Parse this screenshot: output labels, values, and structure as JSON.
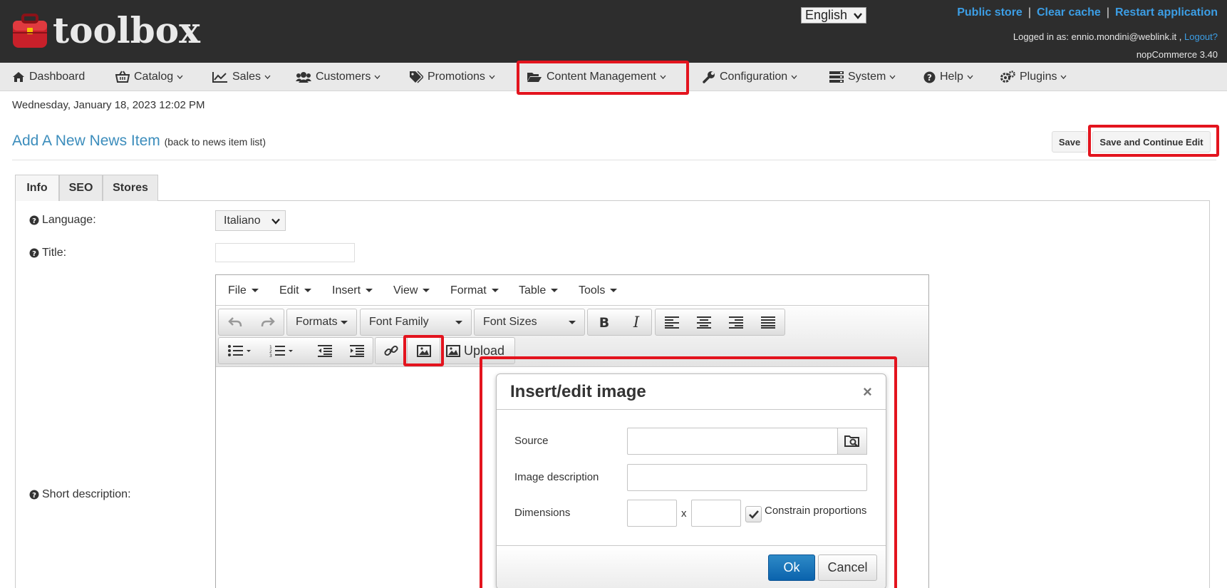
{
  "header": {
    "logo_text": "toolbox",
    "language": "English",
    "links": {
      "public_store": "Public store",
      "clear_cache": "Clear cache",
      "restart": "Restart application"
    },
    "logged_in_prefix": "Logged in as: ennio.mondini@weblink.it ,",
    "logout": "Logout?",
    "version": "nopCommerce 3.40"
  },
  "nav": {
    "items": [
      {
        "label": "Dashboard",
        "icon": "home-icon"
      },
      {
        "label": "Catalog",
        "icon": "basket-icon"
      },
      {
        "label": "Sales",
        "icon": "line-chart-icon"
      },
      {
        "label": "Customers",
        "icon": "users-icon"
      },
      {
        "label": "Promotions",
        "icon": "tags-icon"
      },
      {
        "label": "Content Management",
        "icon": "folder-open-icon"
      },
      {
        "label": "Configuration",
        "icon": "wrench-icon"
      },
      {
        "label": "System",
        "icon": "server-icon"
      },
      {
        "label": "Help",
        "icon": "question-circle-icon"
      },
      {
        "label": "Plugins",
        "icon": "gears-icon"
      }
    ]
  },
  "page": {
    "date": "Wednesday, January 18, 2023 12:02 PM",
    "title": "Add A New News Item",
    "back_link": "(back to news item list)",
    "save": "Save",
    "save_continue": "Save and Continue Edit"
  },
  "tabs": [
    "Info",
    "SEO",
    "Stores"
  ],
  "form": {
    "language_label": "Language:",
    "language_value": "Italiano",
    "title_label": "Title:",
    "short_desc_label": "Short description:"
  },
  "editor": {
    "menu": [
      "File",
      "Edit",
      "Insert",
      "View",
      "Format",
      "Table",
      "Tools"
    ],
    "formats": "Formats",
    "font_family": "Font Family",
    "font_sizes": "Font Sizes",
    "upload": "Upload"
  },
  "dialog": {
    "title": "Insert/edit image",
    "close": "×",
    "source_label": "Source",
    "image_description_label": "Image description",
    "dimensions_label": "Dimensions",
    "dimensions_separator": "x",
    "constrain_label": "Constrain proportions",
    "constrain_checked": true,
    "ok": "Ok",
    "cancel": "Cancel"
  },
  "colors": {
    "header_bg": "#2d2d2d",
    "link": "#3c9ee5",
    "title": "#3c8dbc",
    "highlight": "#e3141e",
    "ok_button": "#0b63ad"
  }
}
